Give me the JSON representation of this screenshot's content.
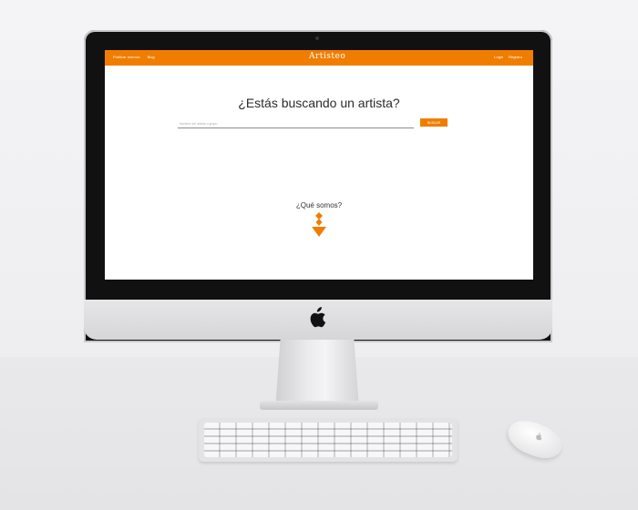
{
  "navbar": {
    "left_links": [
      "Publicar anuncio",
      "Blog"
    ],
    "brand": "Artisteo",
    "right_links": [
      "Login",
      "Registro"
    ]
  },
  "hero": {
    "title": "¿Estás buscando un artista?",
    "search_placeholder": "Nombre del artista o grupo",
    "search_button": "BUSCAR"
  },
  "about": {
    "link_text": "¿Qué somos?"
  },
  "colors": {
    "accent": "#f07d00",
    "text": "#2b2b2b"
  },
  "icons": {
    "scroll": "down-arrow-icon",
    "device": "apple-logo-icon"
  }
}
